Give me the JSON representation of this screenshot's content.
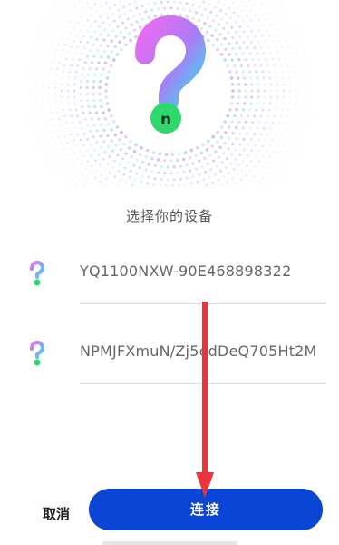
{
  "dialog": {
    "title": "选择你的设备"
  },
  "devices": [
    {
      "name": "YQ1100NXW-90E468898322",
      "icon": "question-mark-device-icon"
    },
    {
      "name": "NPMJFXmuN/Zj5edDeQ705Ht2M",
      "icon": "question-mark-device-icon"
    }
  ],
  "buttons": {
    "cancel_label": "取消",
    "connect_label": "连接"
  },
  "hero": {
    "icon": "question-mark-logo-icon",
    "badge_letter": "n"
  },
  "colors": {
    "accent": "#0a45d6",
    "arrow": "#e8343a",
    "gradient_start": "#e96bf2",
    "gradient_end": "#3dd8f0",
    "badge": "#2fd86a"
  }
}
